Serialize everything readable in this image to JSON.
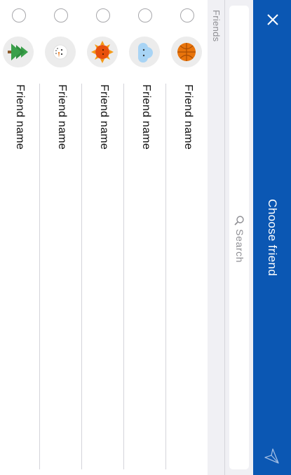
{
  "header": {
    "title": "Choose friend",
    "close_icon": "close-icon",
    "send_icon": "send-icon",
    "background": "#0b57b3"
  },
  "search": {
    "placeholder": "Search",
    "icon": "search-icon"
  },
  "section": {
    "label": "Friends"
  },
  "friends": [
    {
      "name": "Friend name",
      "avatar": "basketball-icon",
      "selected": false
    },
    {
      "name": "Friend name",
      "avatar": "cloud-icon",
      "selected": false
    },
    {
      "name": "Friend name",
      "avatar": "sun-icon",
      "selected": false
    },
    {
      "name": "Friend name",
      "avatar": "snowman-icon",
      "selected": false
    },
    {
      "name": "Friend name",
      "avatar": "tree-icon",
      "selected": false
    }
  ]
}
